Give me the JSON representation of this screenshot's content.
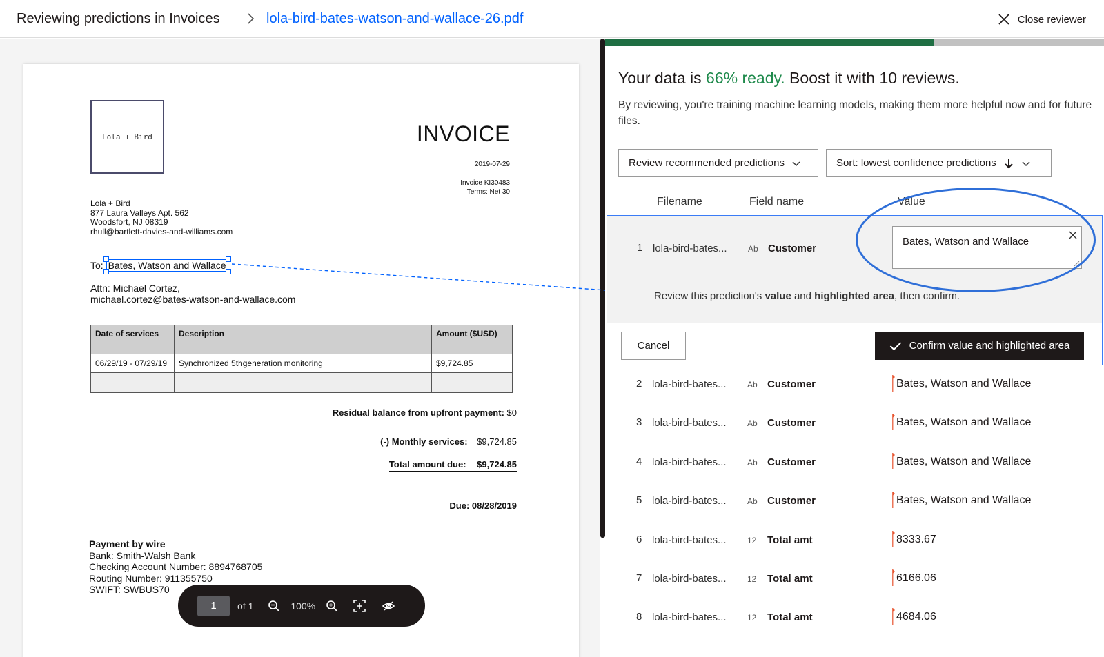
{
  "header": {
    "title": "Reviewing predictions in Invoices",
    "file_link": "lola-bird-bates-watson-and-wallace-26.pdf",
    "close_label": "Close reviewer"
  },
  "document": {
    "logo_text": "Lola + Bird",
    "title": "INVOICE",
    "date": "2019-07-29",
    "invoice_no": "Invoice KI30483",
    "terms": "Terms: Net 30",
    "from_lines": [
      "Lola + Bird",
      "877 Laura Valleys Apt. 562",
      "Woodsfort, NJ 08319",
      "rhull@bartlett-davies-and-williams.com"
    ],
    "to_label": "To:",
    "to_value": "Bates, Watson and Wallace",
    "attn_lines": [
      "Attn: Michael Cortez,",
      "michael.cortez@bates-watson-and-wallace.com"
    ],
    "table": {
      "headers": [
        "Date of services",
        "Description",
        "Amount ($USD)"
      ],
      "rows": [
        [
          "06/29/19 - 07/29/19",
          "Synchronized 5thgeneration monitoring",
          "$9,724.85"
        ]
      ]
    },
    "residual_label": "Residual balance from upfront payment:",
    "residual_value": "$0",
    "monthly_label": "(-) Monthly services:",
    "monthly_value": "$9,724.85",
    "total_label": "Total amount due:",
    "total_value": "$9,724.85",
    "due": "Due: 08/28/2019",
    "payment_title": "Payment by wire",
    "payment_lines": [
      "Bank: Smith-Walsh Bank",
      "Checking Account Number: 8894768705",
      "Routing Number: 911355750",
      "SWIFT: SWBUS70"
    ]
  },
  "toolbar": {
    "page": "1",
    "of_label": "of 1",
    "zoom": "100%"
  },
  "review": {
    "progress_fraction": 0.66,
    "heading_pre": "Your data is ",
    "heading_pct": "66% ready.",
    "heading_post": " Boost it with 10 reviews.",
    "subtext": "By reviewing, you're training machine learning models, making them more helpful now and for future files.",
    "filter_label": "Review recommended predictions",
    "sort_label": "Sort: lowest confidence predictions",
    "col_filename": "Filename",
    "col_field": "Field name",
    "col_value": "Value",
    "focused": {
      "num": "1",
      "file": "lola-bird-bates...",
      "type": "Ab",
      "field": "Customer",
      "value": "Bates, Watson and Wallace",
      "hint_pre": "Review this prediction's ",
      "hint_b1": "value",
      "hint_mid": " and ",
      "hint_b2": "highlighted area",
      "hint_post": ", then confirm.",
      "cancel": "Cancel",
      "confirm": "Confirm value and highlighted area"
    },
    "rows": [
      {
        "num": "2",
        "file": "lola-bird-bates...",
        "type": "Ab",
        "field": "Customer",
        "value": "Bates, Watson and Wallace"
      },
      {
        "num": "3",
        "file": "lola-bird-bates...",
        "type": "Ab",
        "field": "Customer",
        "value": "Bates, Watson and Wallace"
      },
      {
        "num": "4",
        "file": "lola-bird-bates...",
        "type": "Ab",
        "field": "Customer",
        "value": "Bates, Watson and Wallace"
      },
      {
        "num": "5",
        "file": "lola-bird-bates...",
        "type": "Ab",
        "field": "Customer",
        "value": "Bates, Watson and Wallace"
      },
      {
        "num": "6",
        "file": "lola-bird-bates...",
        "type": "12",
        "field": "Total amt",
        "value": "8333.67"
      },
      {
        "num": "7",
        "file": "lola-bird-bates...",
        "type": "12",
        "field": "Total amt",
        "value": "6166.06"
      },
      {
        "num": "8",
        "file": "lola-bird-bates...",
        "type": "12",
        "field": "Total amt",
        "value": "4684.06"
      }
    ],
    "colors": {
      "accent_green": "#1f8a4c",
      "progress_green": "#1f6e43",
      "focus_blue": "#3b7cf6",
      "flag_red": "#e8542f"
    }
  }
}
